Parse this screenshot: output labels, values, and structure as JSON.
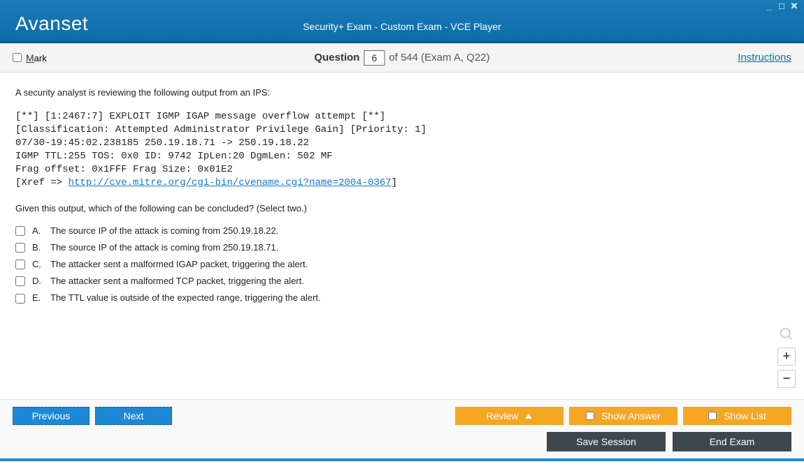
{
  "titlebar": {
    "logo_text": "Avanset",
    "title": "Security+ Exam - Custom Exam - VCE Player"
  },
  "questionbar": {
    "mark_label": "Mark",
    "question_label": "Question",
    "question_number": "6",
    "of_text": "of 544 (Exam A, Q22)",
    "instructions": "Instructions"
  },
  "content": {
    "intro": "A security analyst is reviewing the following output from an IPS:",
    "code_lines": [
      "[**] [1:2467:7] EXPLOIT IGMP IGAP message overflow attempt [**]",
      "[Classification: Attempted Administrator Privilege Gain] [Priority: 1]",
      "07/30-19:45:02.238185 250.19.18.71 -> 250.19.18.22",
      "IGMP TTL:255 TOS: 0x0 ID: 9742 IpLen:20 DgmLen: 502 MF",
      "Frag offset: 0x1FFF Frag Size: 0x01E2"
    ],
    "xref_prefix": "[Xref => ",
    "xref_link": "http://cve.mitre.org/cgi-bin/cvename.cgi?name=2004-0367",
    "xref_suffix": "]",
    "prompt": "Given this output, which of the following can be concluded? (Select two.)",
    "options": [
      {
        "letter": "A.",
        "text": "The source IP of the attack is coming from 250.19.18.22."
      },
      {
        "letter": "B.",
        "text": "The source IP of the attack is coming from 250.19.18.71."
      },
      {
        "letter": "C.",
        "text": "The attacker sent a malformed IGAP packet, triggering the alert."
      },
      {
        "letter": "D.",
        "text": "The attacker sent a malformed TCP packet, triggering the alert."
      },
      {
        "letter": "E.",
        "text": "The TTL value is outside of the expected range, triggering the alert."
      }
    ]
  },
  "zoom": {
    "plus": "+",
    "minus": "−"
  },
  "footer": {
    "previous": "Previous",
    "next": "Next",
    "review": "Review",
    "show_answer": "Show Answer",
    "show_list": "Show List",
    "save_session": "Save Session",
    "end_exam": "End Exam"
  }
}
